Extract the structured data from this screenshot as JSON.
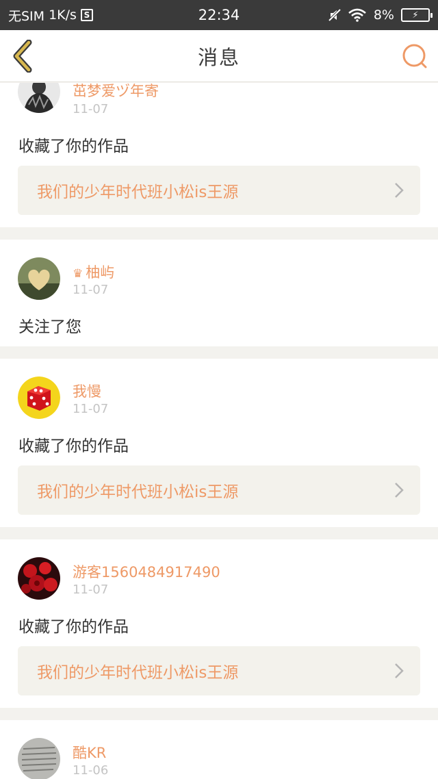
{
  "status_bar": {
    "carrier": "无SIM",
    "speed": "1K/s",
    "sim_icon": "S",
    "time": "22:34",
    "battery_percent": "8%",
    "icons": [
      "mute-icon",
      "wifi-icon",
      "battery-charging-icon"
    ]
  },
  "header": {
    "title": "消息",
    "back_icon": "chevron-left-icon",
    "search_icon": "search-icon"
  },
  "colors": {
    "accent": "#ee9966",
    "back_icon": "#d8b850",
    "background": "#f3f2ee"
  },
  "messages": [
    {
      "username": "茁梦爱ヅ年寄",
      "date": "11-07",
      "action": "收藏了你的作品",
      "work": "我们的少年时代班小松is王源",
      "avatar_icon": "user-photo-avatar",
      "has_crown": false
    },
    {
      "username": "柚屿",
      "date": "11-07",
      "action": "关注了您",
      "work": null,
      "avatar_icon": "heart-photo-avatar",
      "has_crown": true
    },
    {
      "username": "我慢",
      "date": "11-07",
      "action": "收藏了你的作品",
      "work": "我们的少年时代班小松is王源",
      "avatar_icon": "dice-avatar",
      "has_crown": false
    },
    {
      "username": "游客1560484917490",
      "date": "11-07",
      "action": "收藏了你的作品",
      "work": "我们的少年时代班小松is王源",
      "avatar_icon": "roses-avatar",
      "has_crown": false
    },
    {
      "username": "酷KR",
      "date": "11-06",
      "action": "",
      "work": null,
      "avatar_icon": "text-photo-avatar",
      "has_crown": false
    }
  ]
}
